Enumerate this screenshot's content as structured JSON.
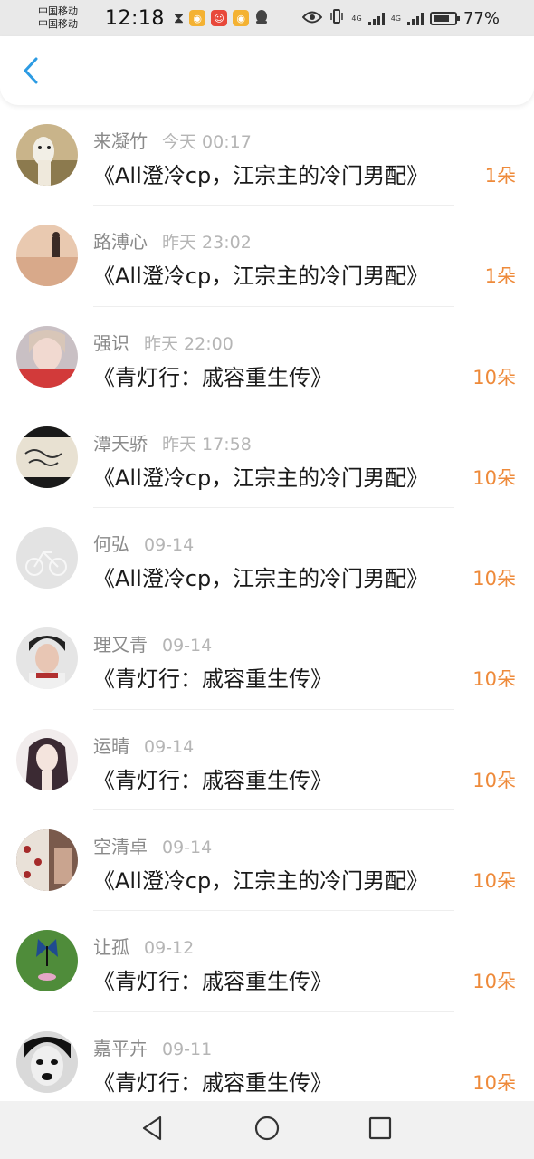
{
  "status_bar": {
    "carrier_1": "中国移动",
    "carrier_2": "中国移动",
    "time": "12:18",
    "net_1": "4G",
    "net_2": "4G",
    "battery": "77%",
    "battery_level": 0.77
  },
  "nav": {
    "back_icon": "chevron-left-icon",
    "accent": "#2c9be3"
  },
  "list": [
    {
      "name": "来凝竹",
      "time": "今天 00:17",
      "book": "《All澄冷cp，江宗主的冷门男配》",
      "count": "1朵"
    },
    {
      "name": "路溥心",
      "time": "昨天 23:02",
      "book": "《All澄冷cp，江宗主的冷门男配》",
      "count": "1朵"
    },
    {
      "name": "强识",
      "time": "昨天 22:00",
      "book": "《青灯行：戚容重生传》",
      "count": "10朵"
    },
    {
      "name": "潭天骄",
      "time": "昨天 17:58",
      "book": "《All澄冷cp，江宗主的冷门男配》",
      "count": "10朵"
    },
    {
      "name": "何弘",
      "time": "09-14",
      "book": "《All澄冷cp，江宗主的冷门男配》",
      "count": "10朵"
    },
    {
      "name": "理又青",
      "time": "09-14",
      "book": "《青灯行：戚容重生传》",
      "count": "10朵"
    },
    {
      "name": "运晴",
      "time": "09-14",
      "book": "《青灯行：戚容重生传》",
      "count": "10朵"
    },
    {
      "name": "空清卓",
      "time": "09-14",
      "book": "《All澄冷cp，江宗主的冷门男配》",
      "count": "10朵"
    },
    {
      "name": "让孤",
      "time": "09-12",
      "book": "《青灯行：戚容重生传》",
      "count": "10朵"
    },
    {
      "name": "嘉平卉",
      "time": "09-11",
      "book": "《青灯行：戚容重生传》",
      "count": "10朵"
    }
  ],
  "colors": {
    "count_orange": "#ee8a3a",
    "name_gray": "#8a8a8a",
    "time_gray": "#b5b5b5"
  },
  "system_nav": {
    "back": "triangle-back-icon",
    "home": "circle-home-icon",
    "recents": "square-recents-icon"
  }
}
